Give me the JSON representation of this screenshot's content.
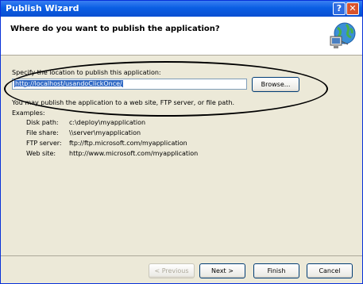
{
  "window": {
    "title": "Publish Wizard",
    "help_glyph": "?",
    "close_glyph": "✕"
  },
  "header": {
    "title": "Where do you want to publish the application?",
    "icon": "globe-network-icon"
  },
  "location": {
    "label": "Specify the location to publish this application:",
    "value": "http://localhost/usandoClickOnce/",
    "browse_label": "Browse..."
  },
  "info": {
    "text": "You may publish the application to a web site, FTP server, or file path."
  },
  "examples": {
    "heading": "Examples:",
    "rows": [
      {
        "label": "Disk path:",
        "value": "c:\\deploy\\myapplication"
      },
      {
        "label": "File share:",
        "value": "\\\\server\\myapplication"
      },
      {
        "label": "FTP server:",
        "value": "ftp://ftp.microsoft.com/myapplication"
      },
      {
        "label": "Web site:",
        "value": "http://www.microsoft.com/myapplication"
      }
    ]
  },
  "buttons": {
    "previous": "< Previous",
    "next": "Next >",
    "finish": "Finish",
    "cancel": "Cancel"
  }
}
